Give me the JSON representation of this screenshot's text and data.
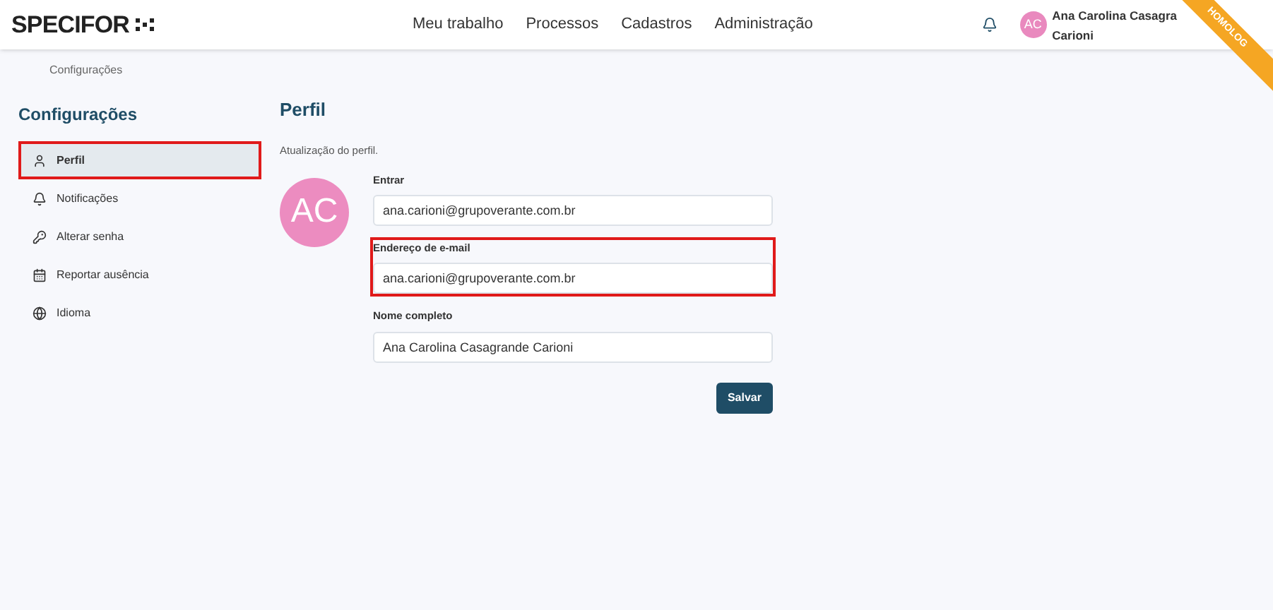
{
  "header": {
    "logo": "SPECIFOR",
    "nav": [
      {
        "label": "Meu trabalho"
      },
      {
        "label": "Processos"
      },
      {
        "label": "Cadastros"
      },
      {
        "label": "Administração"
      }
    ],
    "user": {
      "initials": "AC",
      "name_line_1": "Ana Carolina Casagra",
      "name_line_2": "Carioni"
    },
    "ribbon": "HOMOLOG"
  },
  "breadcrumb": "Configurações",
  "sidebar": {
    "title": "Configurações",
    "items": [
      {
        "label": "Perfil",
        "kind": "user",
        "selected": true,
        "highlighted": true
      },
      {
        "label": "Notificações",
        "kind": "bell",
        "selected": false,
        "highlighted": false
      },
      {
        "label": "Alterar senha",
        "kind": "key",
        "selected": false,
        "highlighted": false
      },
      {
        "label": "Reportar ausência",
        "kind": "calendar",
        "selected": false,
        "highlighted": false
      },
      {
        "label": "Idioma",
        "kind": "globe",
        "selected": false,
        "highlighted": false
      }
    ]
  },
  "profile": {
    "title": "Perfil",
    "subtitle": "Atualização do perfil.",
    "avatar": "AC",
    "fields": [
      {
        "label": "Entrar",
        "value": "ana.carioni@grupoverante.com.br",
        "highlighted": false
      },
      {
        "label": "Endereço de e-mail",
        "value": "ana.carioni@grupoverante.com.br",
        "highlighted": true
      },
      {
        "label": "Nome completo",
        "value": "Ana Carolina Casagrande Carioni",
        "highlighted": false
      }
    ],
    "save": "Salvar"
  }
}
